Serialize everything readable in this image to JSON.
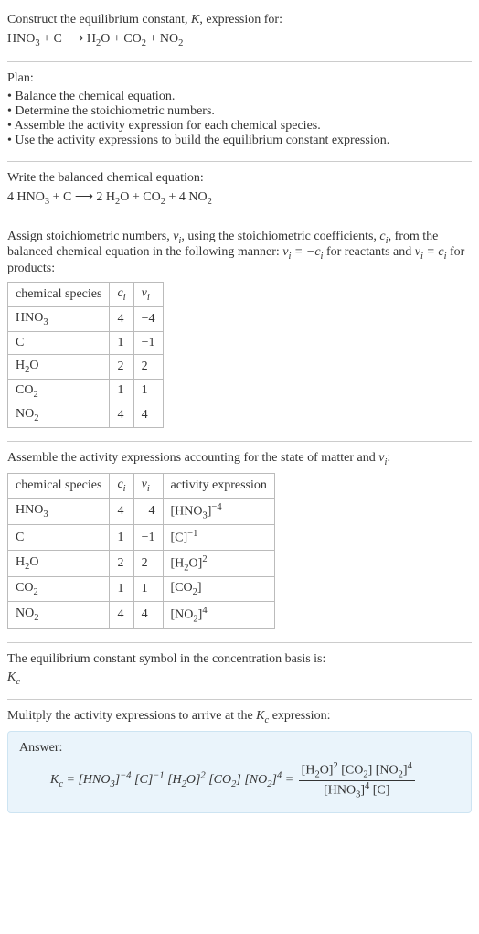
{
  "intro": {
    "line1_a": "Construct the equilibrium constant, ",
    "line1_b": ", expression for:",
    "K": "K",
    "equation_html": "HNO<sub>3</sub> + C ⟶ H<sub>2</sub>O + CO<sub>2</sub> + NO<sub>2</sub>"
  },
  "plan": {
    "title": "Plan:",
    "items": [
      "Balance the chemical equation.",
      "Determine the stoichiometric numbers.",
      "Assemble the activity expression for each chemical species.",
      "Use the activity expressions to build the equilibrium constant expression."
    ]
  },
  "balanced": {
    "line": "Write the balanced chemical equation:",
    "equation_html": "4 HNO<sub>3</sub> + C ⟶ 2 H<sub>2</sub>O + CO<sub>2</sub> + 4 NO<sub>2</sub>"
  },
  "stoich_text": {
    "part1": "Assign stoichiometric numbers, ",
    "nu_i": "ν<sub>i</sub>",
    "part2": ", using the stoichiometric coefficients, ",
    "c_i": "c<sub>i</sub>",
    "part3": ", from the balanced chemical equation in the following manner: ",
    "rel1": "ν<sub>i</sub> = −c<sub>i</sub>",
    "part4": " for reactants and ",
    "rel2": "ν<sub>i</sub> = c<sub>i</sub>",
    "part5": " for products:"
  },
  "table1": {
    "headers": [
      "chemical species",
      "c<sub>i</sub>",
      "ν<sub>i</sub>"
    ],
    "rows": [
      [
        "HNO<sub>3</sub>",
        "4",
        "−4"
      ],
      [
        "C",
        "1",
        "−1"
      ],
      [
        "H<sub>2</sub>O",
        "2",
        "2"
      ],
      [
        "CO<sub>2</sub>",
        "1",
        "1"
      ],
      [
        "NO<sub>2</sub>",
        "4",
        "4"
      ]
    ]
  },
  "activity_text": {
    "part1": "Assemble the activity expressions accounting for the state of matter and ",
    "nu_i": "ν<sub>i</sub>",
    "part2": ":"
  },
  "table2": {
    "headers": [
      "chemical species",
      "c<sub>i</sub>",
      "ν<sub>i</sub>",
      "activity expression"
    ],
    "rows": [
      [
        "HNO<sub>3</sub>",
        "4",
        "−4",
        "[HNO<sub>3</sub>]<sup>−4</sup>"
      ],
      [
        "C",
        "1",
        "−1",
        "[C]<sup>−1</sup>"
      ],
      [
        "H<sub>2</sub>O",
        "2",
        "2",
        "[H<sub>2</sub>O]<sup>2</sup>"
      ],
      [
        "CO<sub>2</sub>",
        "1",
        "1",
        "[CO<sub>2</sub>]"
      ],
      [
        "NO<sub>2</sub>",
        "4",
        "4",
        "[NO<sub>2</sub>]<sup>4</sup>"
      ]
    ]
  },
  "kc_symbol": {
    "line": "The equilibrium constant symbol in the concentration basis is:",
    "sym": "K<sub>c</sub>"
  },
  "multiply": {
    "line_a": "Mulitply the activity expressions to arrive at the ",
    "kc": "K<sub>c</sub>",
    "line_b": " expression:"
  },
  "answer": {
    "label": "Answer:",
    "lhs": "K<sub>c</sub> = [HNO<sub>3</sub>]<sup>−4</sup> [C]<sup>−1</sup> [H<sub>2</sub>O]<sup>2</sup> [CO<sub>2</sub>] [NO<sub>2</sub>]<sup>4</sup> = ",
    "num": "[H<sub>2</sub>O]<sup>2</sup> [CO<sub>2</sub>] [NO<sub>2</sub>]<sup>4</sup>",
    "den": "[HNO<sub>3</sub>]<sup>4</sup> [C]"
  }
}
